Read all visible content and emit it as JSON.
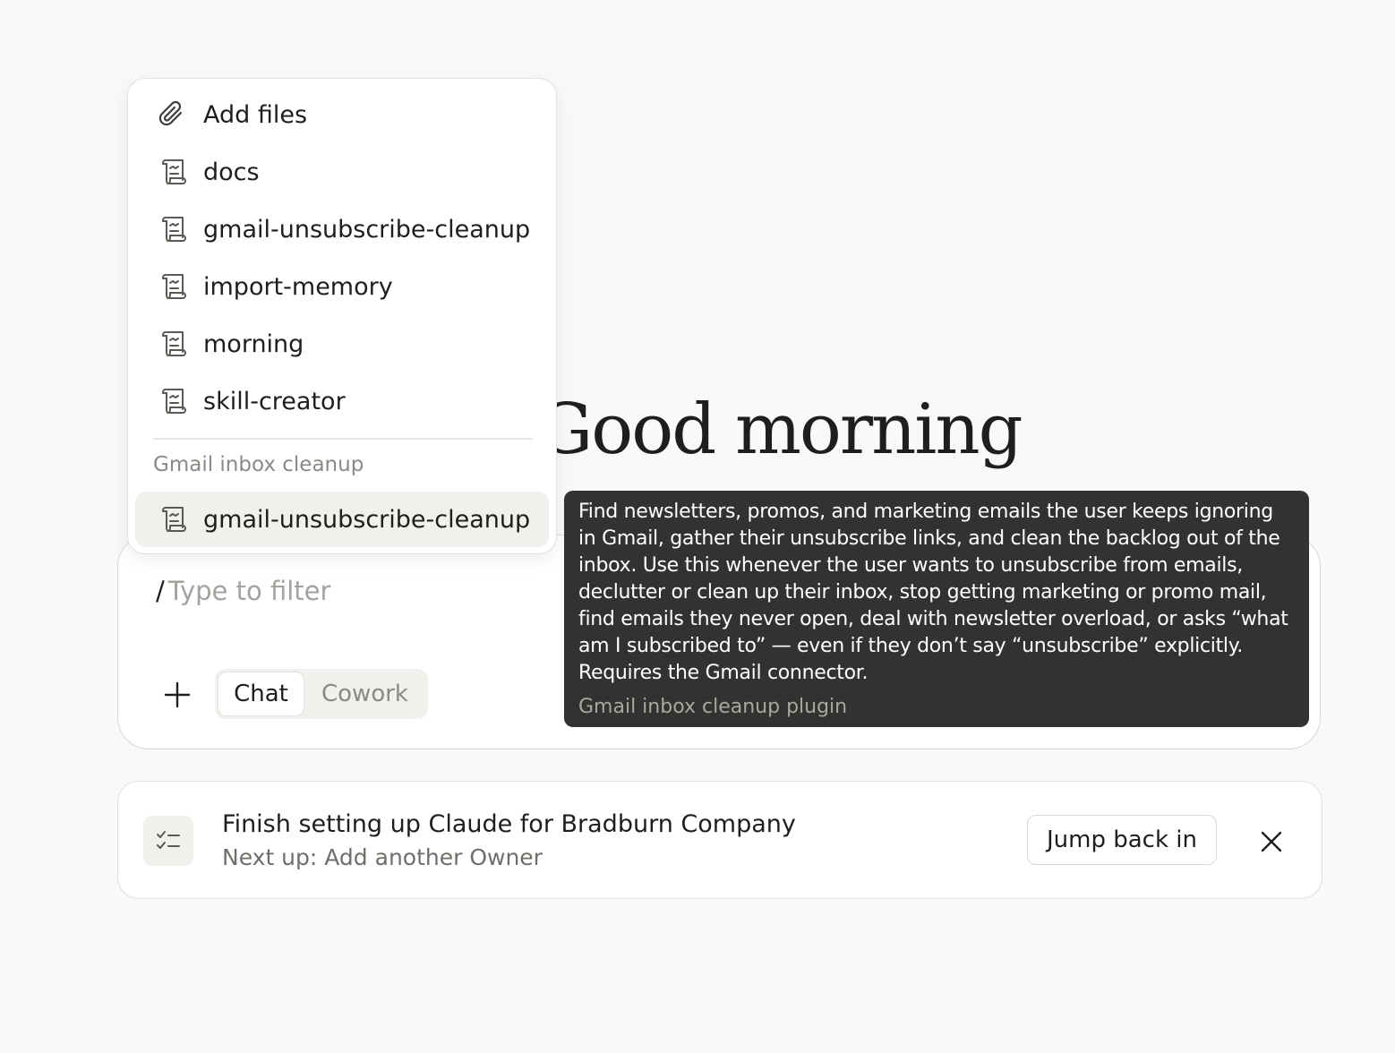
{
  "greeting": "Good morning",
  "menu": {
    "items": [
      {
        "label": "Add files",
        "icon": "paperclip-icon"
      },
      {
        "label": "docs",
        "icon": "scroll-icon"
      },
      {
        "label": "gmail-unsubscribe-cleanup",
        "icon": "scroll-icon"
      },
      {
        "label": "import-memory",
        "icon": "scroll-icon"
      },
      {
        "label": "morning",
        "icon": "scroll-icon"
      },
      {
        "label": "skill-creator",
        "icon": "scroll-icon"
      }
    ],
    "section": {
      "title": "Gmail inbox cleanup",
      "items": [
        {
          "label": "gmail-unsubscribe-cleanup",
          "icon": "scroll-icon",
          "highlighted": true
        }
      ]
    }
  },
  "tooltip": {
    "description": "Find newsletters, promos, and marketing emails the user keeps ignoring in Gmail, gather their unsubscribe links, and clean the backlog out of the inbox. Use this whenever the user wants to unsubscribe from emails, declutter or clean up their inbox, stop getting marketing or promo mail, find emails they never open, deal with newsletter overload, or asks “what am I subscribed to” — even if they don’t say “unsubscribe” explicitly. Requires the Gmail connector.",
    "source": "Gmail inbox cleanup plugin"
  },
  "composer": {
    "prefix": "/",
    "placeholder": "Type to filter",
    "modes": [
      "Chat",
      "Cowork"
    ],
    "active_mode": "Chat"
  },
  "setup_card": {
    "title": "Finish setting up Claude for Bradburn Company",
    "subtitle": "Next up: Add another Owner",
    "button": "Jump back in"
  },
  "colors": {
    "background": "#f9f9f8",
    "accent": "#c96442",
    "tooltip_bg": "#333231"
  }
}
